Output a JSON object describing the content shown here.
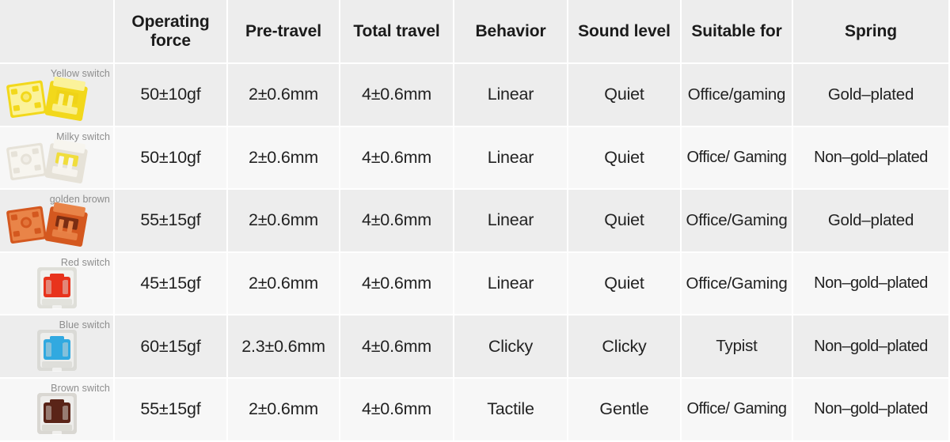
{
  "table": {
    "columns": [
      {
        "key": "switch",
        "label": ""
      },
      {
        "key": "operating_force",
        "label": "Operating force"
      },
      {
        "key": "pre_travel",
        "label": "Pre-travel"
      },
      {
        "key": "total_travel",
        "label": "Total travel"
      },
      {
        "key": "behavior",
        "label": "Behavior"
      },
      {
        "key": "sound_level",
        "label": "Sound level"
      },
      {
        "key": "suitable_for",
        "label": "Suitable for"
      },
      {
        "key": "spring",
        "label": "Spring"
      }
    ],
    "header": {
      "blank": "",
      "operating_force_line1": "Operating",
      "operating_force_line2": "force",
      "pre_travel": "Pre-travel",
      "total_travel": "Total travel",
      "behavior": "Behavior",
      "sound_level": "Sound level",
      "suitable_for": "Suitable for",
      "spring": "Spring"
    },
    "rows": [
      {
        "name": "Yellow switch",
        "art": "yellow-switch-pair",
        "operating_force": "50±10gf",
        "pre_travel": "2±0.6mm",
        "total_travel": "4±0.6mm",
        "behavior": "Linear",
        "sound_level": "Quiet",
        "suitable_for": "Office/gaming",
        "spring": "Gold–plated"
      },
      {
        "name": "Milky switch",
        "art": "milky-switch-pair",
        "operating_force": "50±10gf",
        "pre_travel": "2±0.6mm",
        "total_travel": "4±0.6mm",
        "behavior": "Linear",
        "sound_level": "Quiet",
        "suitable_for": "Office/ Gaming",
        "spring": "Non–gold–plated"
      },
      {
        "name": "golden brown",
        "art": "golden-brown-switch-pair",
        "operating_force": "55±15gf",
        "pre_travel": "2±0.6mm",
        "total_travel": "4±0.6mm",
        "behavior": "Linear",
        "sound_level": "Quiet",
        "suitable_for": "Office/Gaming",
        "spring": "Gold–plated"
      },
      {
        "name": "Red switch",
        "art": "red-switch-single",
        "operating_force": "45±15gf",
        "pre_travel": "2±0.6mm",
        "total_travel": "4±0.6mm",
        "behavior": "Linear",
        "sound_level": "Quiet",
        "suitable_for": "Office/Gaming",
        "spring": "Non–gold–plated"
      },
      {
        "name": "Blue switch",
        "art": "blue-switch-single",
        "operating_force": "60±15gf",
        "pre_travel": "2.3±0.6mm",
        "total_travel": "4±0.6mm",
        "behavior": "Clicky",
        "sound_level": "Clicky",
        "suitable_for": "Typist",
        "spring": "Non–gold–plated"
      },
      {
        "name": "Brown switch",
        "art": "brown-switch-single",
        "operating_force": "55±15gf",
        "pre_travel": "2±0.6mm",
        "total_travel": "4±0.6mm",
        "behavior": "Tactile",
        "sound_level": "Gentle",
        "suitable_for": "Office/ Gaming",
        "spring": "Non–gold–plated"
      }
    ]
  },
  "colors": {
    "header_bg": "#ededed",
    "row_even_bg": "#ededed",
    "row_odd_bg": "#f7f7f7",
    "gap": "#ffffff",
    "text": "#222222",
    "caption_text": "#8d8d8d",
    "yellow_switch": "#f2d81b",
    "milky_switch": "#e8e4da",
    "golden_brown_switch": "#d4581f",
    "red_switch": "#e8331c",
    "blue_switch": "#31a9e0",
    "brown_switch": "#5a2418"
  }
}
